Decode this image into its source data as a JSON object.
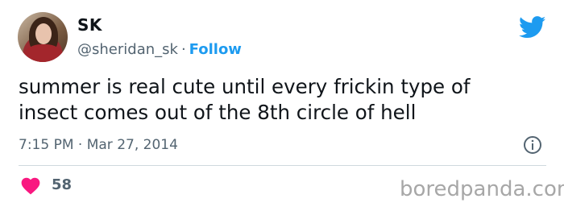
{
  "tweet": {
    "author_name": "SK",
    "author_handle": "@sheridan_sk",
    "separator": "·",
    "follow_label": "Follow",
    "text": "summer is real cute until every frickin type of\ninsect comes out of the 8th circle of hell",
    "timestamp": "7:15 PM · Mar 27, 2014",
    "likes_count": "58"
  },
  "icons": {
    "brand": "twitter-bird-icon",
    "info": "info-icon",
    "like": "heart-icon"
  },
  "colors": {
    "brand_blue": "#1d9bf0",
    "like_red": "#f91880",
    "secondary_text": "#536471"
  },
  "watermark": "boredpanda.com"
}
